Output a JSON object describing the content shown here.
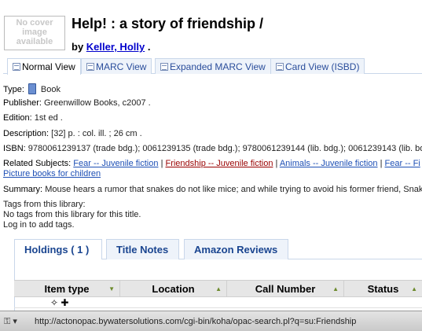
{
  "cover": {
    "line1": "No cover",
    "line2": "image",
    "line3": "available"
  },
  "title": "Help! : a story of friendship /",
  "byline": {
    "prefix": "by",
    "author": "Keller, Holly",
    "suffix": "."
  },
  "view_tabs": [
    {
      "label": "Normal View"
    },
    {
      "label": "MARC View"
    },
    {
      "label": "Expanded MARC View"
    },
    {
      "label": "Card View (ISBD)"
    }
  ],
  "details": {
    "type_label": "Type:",
    "type_value": "Book",
    "publisher_label": "Publisher:",
    "publisher_value": "Greenwillow Books, c2007 .",
    "edition_label": "Edition:",
    "edition_value": "1st ed .",
    "description_label": "Description:",
    "description_value": "[32] p. : col. ill. ; 26 cm .",
    "isbn_label": "ISBN:",
    "isbn_value": "9780061239137 (trade bdg.); 0061239135 (trade bdg.); 9780061239144 (lib. bdg.); 0061239143 (lib. bo",
    "subjects_label": "Related Subjects:",
    "subjects": [
      "Fear -- Juvenile fiction",
      "Friendship -- Juvenile fiction",
      "Animals -- Juvenile fiction",
      "Fear -- Fi"
    ],
    "subjects_line2": "Picture books for children",
    "separator": "|",
    "summary_label": "Summary:",
    "summary_value": "Mouse hears a rumor that snakes do not like mice; and while trying to avoid his former friend, Snak",
    "tags_heading": "Tags from this library:",
    "tags_none": "No tags from this library for this title.",
    "tags_login": "Log in to add tags."
  },
  "holding_tabs": [
    {
      "label": "Holdings ( 1 )"
    },
    {
      "label": "Title Notes"
    },
    {
      "label": "Amazon Reviews"
    }
  ],
  "table": {
    "headers": [
      "Item type",
      "Location",
      "Call Number",
      "Status"
    ],
    "first_cell": "✧ ✚"
  },
  "statusbar": {
    "url": "http://actonopac.bywatersolutions.com/cgi-bin/koha/opac-search.pl?q=su:Friendship"
  }
}
